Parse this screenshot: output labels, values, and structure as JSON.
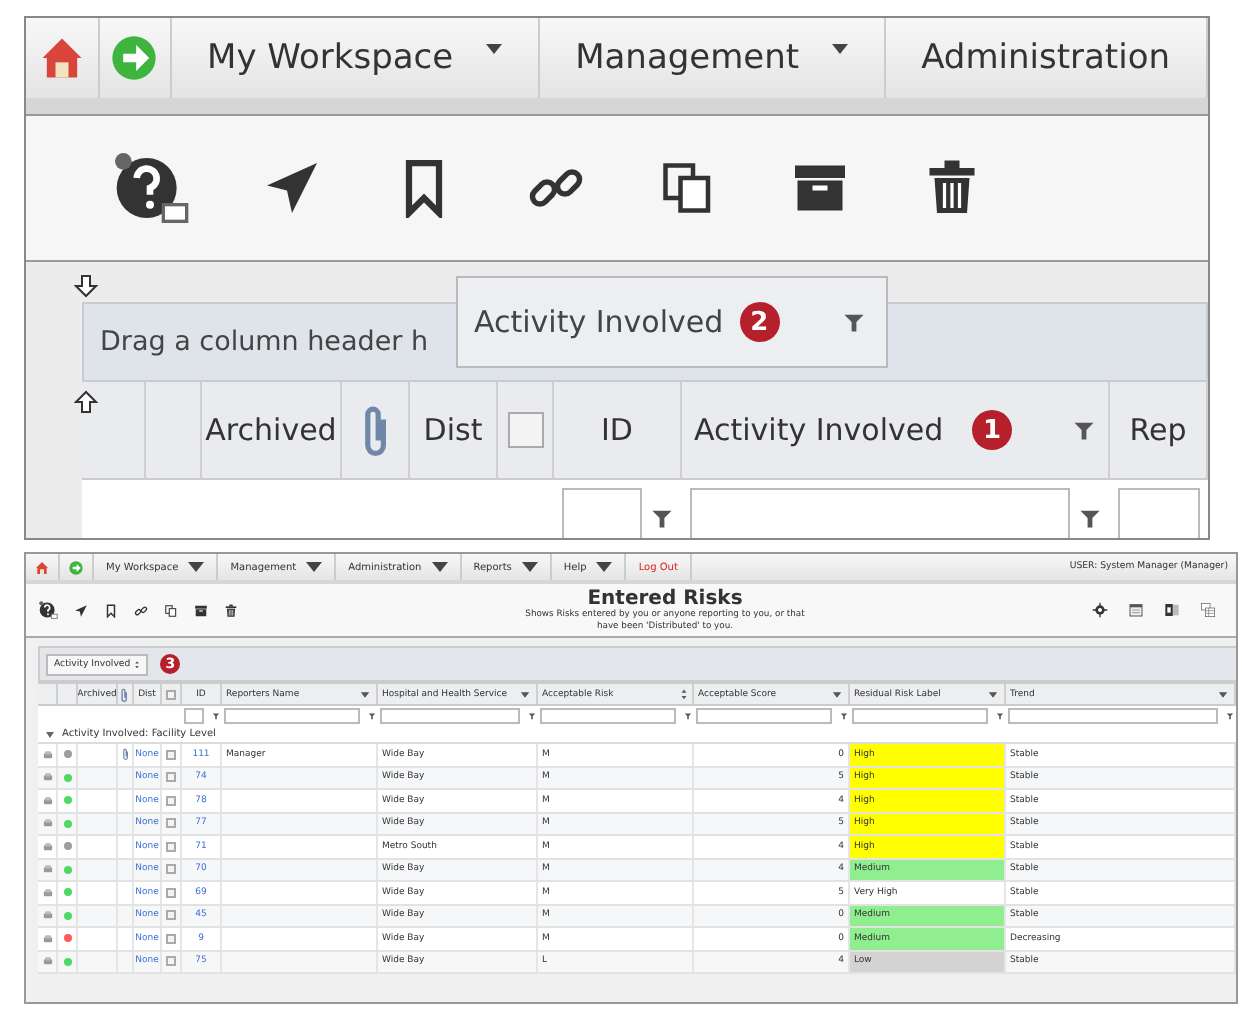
{
  "zoomed": {
    "nav": [
      {
        "kind": "home"
      },
      {
        "kind": "go"
      },
      {
        "kind": "menu",
        "label": "My Workspace"
      },
      {
        "kind": "menu",
        "label": "Management"
      },
      {
        "kind": "plain",
        "label": "Administration"
      }
    ],
    "group_hint": "Drag a column header h",
    "drag_chip": {
      "label": "Activity Involved",
      "badge": "2"
    },
    "columns": [
      {
        "kind": "blank"
      },
      {
        "kind": "blank"
      },
      {
        "kind": "text",
        "label": "Archived"
      },
      {
        "kind": "clip"
      },
      {
        "kind": "text",
        "label": "Dist"
      },
      {
        "kind": "checkbox",
        "checked": false
      },
      {
        "kind": "text",
        "label": "ID",
        "filter": true
      },
      {
        "kind": "text",
        "label": "Activity Involved",
        "badge": "1",
        "menu": true,
        "filter": true
      },
      {
        "kind": "text",
        "label": "Rep",
        "filter": true
      }
    ]
  },
  "full": {
    "nav": [
      {
        "kind": "home"
      },
      {
        "kind": "go"
      },
      {
        "kind": "menu",
        "label": "My Workspace"
      },
      {
        "kind": "menu",
        "label": "Management"
      },
      {
        "kind": "menu",
        "label": "Administration"
      },
      {
        "kind": "menu",
        "label": "Reports"
      },
      {
        "kind": "menu",
        "label": "Help"
      },
      {
        "kind": "logout",
        "label": "Log Out"
      }
    ],
    "user": "USER: System Manager (Manager)",
    "title": "Entered Risks",
    "subtitle": "Shows Risks entered by you or anyone reporting to you, or that have been 'Distributed' to you.",
    "group_chip": {
      "label": "Activity Involved",
      "badge": "3"
    },
    "columns": [
      {
        "kind": "blank"
      },
      {
        "kind": "blank"
      },
      {
        "kind": "text",
        "label": "Archived"
      },
      {
        "kind": "clip"
      },
      {
        "kind": "text",
        "label": "Dist"
      },
      {
        "kind": "checkbox",
        "checked": false
      },
      {
        "kind": "text",
        "label": "ID",
        "filter": true
      },
      {
        "kind": "text",
        "label": "Reporters Name",
        "menu": true,
        "filter": true
      },
      {
        "kind": "text",
        "label": "Hospital and Health Service",
        "menu": true,
        "filter": true
      },
      {
        "kind": "text",
        "label": "Acceptable Risk",
        "sort": true,
        "filter": true
      },
      {
        "kind": "text",
        "label": "Acceptable Score",
        "menu": true,
        "filter": true
      },
      {
        "kind": "text",
        "label": "Residual Risk Label",
        "menu": true,
        "filter": true
      },
      {
        "kind": "text",
        "label": "Trend",
        "menu": true,
        "filter": true
      }
    ],
    "group": {
      "label": "Activity Involved: Facility Level",
      "expanded": true
    },
    "rows": [
      {
        "status": {
          "color": "#9e9e9e"
        },
        "attachment": true,
        "dist": "None",
        "checked": false,
        "id": "111",
        "reporter": "Manager",
        "hospital": "Wide Bay",
        "risk": "M",
        "score": "0",
        "residual": {
          "label": "High",
          "color": "#ffff00"
        },
        "trend": "Stable"
      },
      {
        "status": {
          "color": "#4cd964"
        },
        "attachment": false,
        "dist": "None",
        "checked": false,
        "id": "74",
        "hospital": "Wide Bay",
        "risk": "M",
        "score": "5",
        "residual": {
          "label": "High",
          "color": "#ffff00"
        },
        "trend": "Stable"
      },
      {
        "status": {
          "color": "#4cd964"
        },
        "attachment": false,
        "dist": "None",
        "checked": false,
        "id": "78",
        "hospital": "Wide Bay",
        "risk": "M",
        "score": "4",
        "residual": {
          "label": "High",
          "color": "#ffff00"
        },
        "trend": "Stable"
      },
      {
        "status": {
          "color": "#4cd964"
        },
        "attachment": false,
        "dist": "None",
        "checked": false,
        "id": "77",
        "hospital": "Wide Bay",
        "risk": "M",
        "score": "5",
        "residual": {
          "label": "High",
          "color": "#ffff00"
        },
        "trend": "Stable"
      },
      {
        "status": {
          "color": "#9e9e9e"
        },
        "attachment": false,
        "dist": "None",
        "checked": false,
        "id": "71",
        "hospital": "Metro South",
        "risk": "M",
        "score": "4",
        "residual": {
          "label": "High",
          "color": "#ffff00"
        },
        "trend": "Stable"
      },
      {
        "status": {
          "color": "#4cd964"
        },
        "attachment": false,
        "dist": "None",
        "checked": false,
        "id": "70",
        "hospital": "Wide Bay",
        "risk": "M",
        "score": "4",
        "residual": {
          "label": "Medium",
          "color": "#90ee90"
        },
        "trend": "Stable"
      },
      {
        "status": {
          "color": "#4cd964"
        },
        "attachment": false,
        "dist": "None",
        "checked": false,
        "id": "69",
        "hospital": "Wide Bay",
        "risk": "M",
        "score": "5",
        "residual": {
          "label": "Very High",
          "color": "#ffffff"
        },
        "trend": "Stable"
      },
      {
        "status": {
          "color": "#4cd964"
        },
        "attachment": false,
        "dist": "None",
        "checked": false,
        "id": "45",
        "hospital": "Wide Bay",
        "risk": "M",
        "score": "0",
        "residual": {
          "label": "Medium",
          "color": "#90ee90"
        },
        "trend": "Stable"
      },
      {
        "status": {
          "color": "#ff5a5a"
        },
        "attachment": false,
        "dist": "None",
        "checked": false,
        "id": "9",
        "hospital": "Wide Bay",
        "risk": "M",
        "score": "0",
        "residual": {
          "label": "Medium",
          "color": "#90ee90"
        },
        "trend": "Decreasing"
      },
      {
        "status": {
          "color": "#4cd964"
        },
        "attachment": false,
        "dist": "None",
        "checked": false,
        "id": "75",
        "hospital": "Wide Bay",
        "risk": "L",
        "score": "4",
        "residual": {
          "label": "Low",
          "color": "#d3d3d3"
        },
        "trend": "Stable"
      }
    ]
  }
}
